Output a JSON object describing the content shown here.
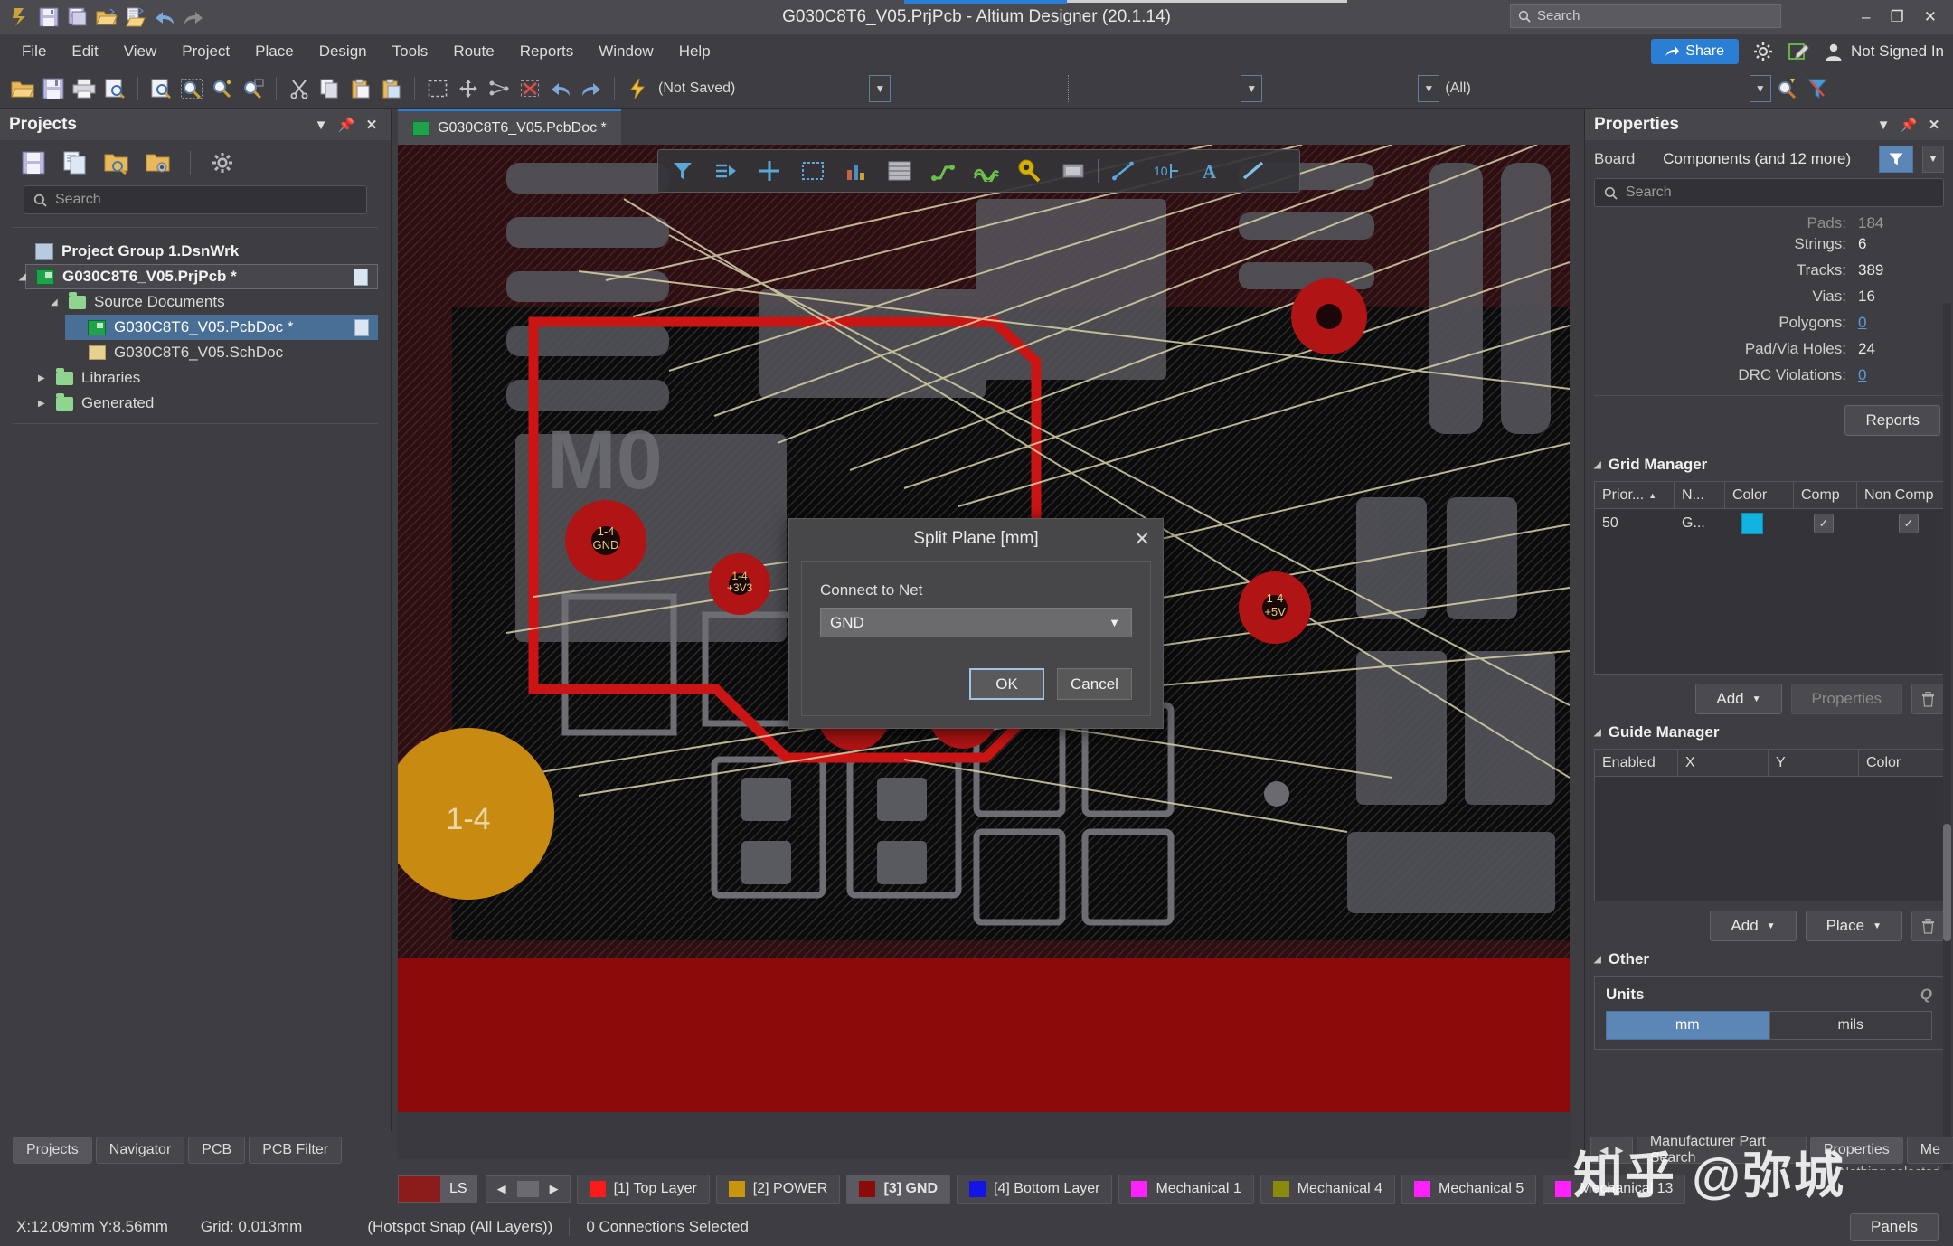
{
  "window": {
    "title": "G030C8T6_V05.PrjPcb - Altium Designer (20.1.14)",
    "search_placeholder": "Search",
    "minimize": "–",
    "maximize": "❐",
    "close": "✕"
  },
  "menu": {
    "items": [
      "File",
      "Edit",
      "View",
      "Project",
      "Place",
      "Design",
      "Tools",
      "Route",
      "Reports",
      "Window",
      "Help"
    ],
    "share_label": "Share",
    "account_label": "Not Signed In"
  },
  "toolbar": {
    "not_saved": "(Not Saved)",
    "all": "(All)"
  },
  "projects_panel": {
    "title": "Projects",
    "search_placeholder": "Search",
    "tree": [
      {
        "label": "Project Group 1.DsnWrk",
        "icon": "project-group-icon",
        "indent": 0,
        "bold": true,
        "arrow": "",
        "selected": false
      },
      {
        "label": "G030C8T6_V05.PrjPcb *",
        "icon": "pcb-project-icon",
        "indent": 1,
        "bold": true,
        "arrow": "◢",
        "selected": false,
        "boxed": true,
        "dirty": true
      },
      {
        "label": "Source Documents",
        "icon": "folder-icon",
        "indent": 2,
        "bold": false,
        "arrow": "◢",
        "selected": false
      },
      {
        "label": "G030C8T6_V05.PcbDoc *",
        "icon": "pcbdoc-icon",
        "indent": 3,
        "bold": false,
        "arrow": "",
        "selected": true,
        "dirty": true
      },
      {
        "label": "G030C8T6_V05.SchDoc",
        "icon": "schdoc-icon",
        "indent": 3,
        "bold": false,
        "arrow": "",
        "selected": false
      },
      {
        "label": "Libraries",
        "icon": "folder-icon",
        "indent": 1,
        "bold": false,
        "arrow": "▶",
        "selected": false
      },
      {
        "label": "Generated",
        "icon": "folder-icon",
        "indent": 1,
        "bold": false,
        "arrow": "▶",
        "selected": false
      }
    ],
    "tabs": [
      "Projects",
      "Navigator",
      "PCB",
      "PCB Filter"
    ],
    "active_tab": "Projects"
  },
  "document_tab": {
    "label": "G030C8T6_V05.PcbDoc *"
  },
  "dialog": {
    "title": "Split Plane [mm]",
    "field_label": "Connect to Net",
    "net_value": "GND",
    "ok": "OK",
    "cancel": "Cancel",
    "close": "✕"
  },
  "properties_panel": {
    "title": "Properties",
    "object_kind": "Board",
    "selection": "Components (and 12 more)",
    "search_placeholder": "Search",
    "stats": [
      {
        "key": "Pads:",
        "value": "184",
        "link": false,
        "clipped": true
      },
      {
        "key": "Strings:",
        "value": "6",
        "link": false
      },
      {
        "key": "Tracks:",
        "value": "389",
        "link": false
      },
      {
        "key": "Vias:",
        "value": "16",
        "link": false
      },
      {
        "key": "Polygons:",
        "value": "0",
        "link": true
      },
      {
        "key": "Pad/Via Holes:",
        "value": "24",
        "link": false
      },
      {
        "key": "DRC Violations:",
        "value": "0",
        "link": true
      }
    ],
    "reports_button": "Reports",
    "grid_manager": {
      "title": "Grid Manager",
      "columns": [
        "Prior...",
        "N...",
        "Color",
        "Comp",
        "Non Comp"
      ],
      "rows": [
        {
          "priority": "50",
          "name": "G...",
          "color": "#11b3e0",
          "comp": true,
          "non_comp": true
        }
      ],
      "add_button": "Add",
      "properties_button": "Properties"
    },
    "guide_manager": {
      "title": "Guide Manager",
      "columns": [
        "Enabled",
        "X",
        "Y",
        "Color"
      ],
      "rows": [],
      "add_button": "Add",
      "place_button": "Place"
    },
    "other": {
      "title": "Other",
      "units_label": "Units",
      "units_options": [
        "mm",
        "mils"
      ],
      "units_selected": "mm"
    },
    "nothing_selected": "Nothing selected",
    "tabs": [
      "Manufacturer Part Search",
      "Properties",
      "Me"
    ],
    "active_tab": "Properties"
  },
  "layer_bar": {
    "ls_label": "LS",
    "ls_color": "#8b1a1a",
    "layers": [
      {
        "label": "[1] Top Layer",
        "color": "#ff1a1a",
        "active": false
      },
      {
        "label": "[2] POWER",
        "color": "#c8960c",
        "active": false
      },
      {
        "label": "[3] GND",
        "color": "#8b0b0b",
        "active": true
      },
      {
        "label": "[4] Bottom Layer",
        "color": "#1414e6",
        "active": false
      },
      {
        "label": "Mechanical 1",
        "color": "#ff22ff",
        "active": false
      },
      {
        "label": "Mechanical 4",
        "color": "#8a8a0a",
        "active": false
      },
      {
        "label": "Mechanical 5",
        "color": "#ff22ff",
        "active": false
      },
      {
        "label": "Mechanical 13",
        "color": "#ff22ff",
        "active": false
      }
    ]
  },
  "status_bar": {
    "coords": "X:12.09mm Y:8.56mm",
    "grid": "Grid: 0.013mm",
    "snap": "(Hotspot Snap (All Layers))",
    "connections": "0 Connections Selected",
    "panels_button": "Panels"
  },
  "canvas": {
    "pad_labels": [
      "1-4",
      "1-4 GND",
      "1-4 +3V3",
      "1-4 +5V",
      "1-4 GND",
      "1-4 +3V3"
    ],
    "big_pad_label": "1-4",
    "silkscreen_text": "M0"
  },
  "watermark": "知乎 @弥城"
}
